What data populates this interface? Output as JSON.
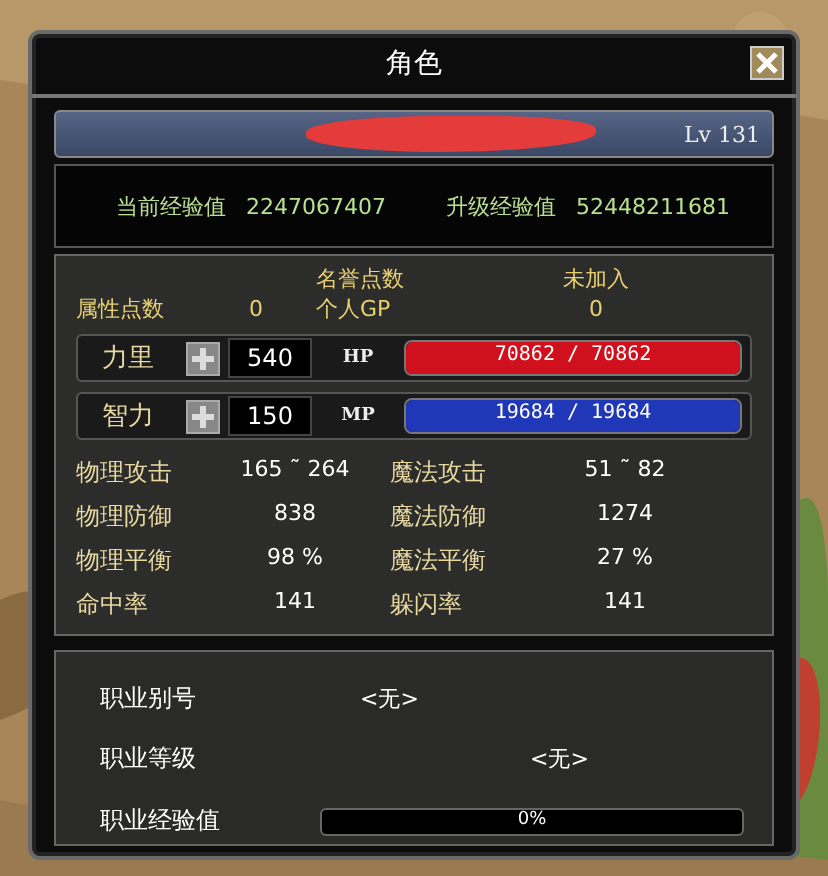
{
  "window": {
    "title": "角色"
  },
  "character": {
    "level": "Lv 131",
    "redacted": true
  },
  "experience": {
    "current_label": "当前经验值",
    "current": "2247067407",
    "next_label": "升级经验值",
    "next": "52448211681"
  },
  "points": {
    "attribute_label": "属性点数",
    "attribute": "0",
    "honor_label": "名誉点数",
    "honor": "未加入",
    "gp_label": "个人GP",
    "gp": "0"
  },
  "attributes": [
    {
      "label": "力里",
      "value": "540",
      "bar_label": "HP",
      "reading": "70862 / 70862",
      "level": 1,
      "color": "#d0101c"
    },
    {
      "label": "智力",
      "value": "150",
      "bar_label": "MP",
      "reading": "19684 / 19684",
      "level": 1,
      "color": "#2038b8"
    }
  ],
  "stats": [
    {
      "label": "物理攻击",
      "value": "165 ˜ 264"
    },
    {
      "label": "魔法攻击",
      "value": "51 ˜ 82"
    },
    {
      "label": "物理防御",
      "value": "838"
    },
    {
      "label": "魔法防御",
      "value": "1274"
    },
    {
      "label": "物理平衡",
      "value": "98 %"
    },
    {
      "label": "魔法平衡",
      "value": "27 %"
    },
    {
      "label": "命中率",
      "value": "141"
    },
    {
      "label": "躲闪率",
      "value": "141"
    }
  ],
  "job": {
    "alias_label": "职业别号",
    "alias": "<无>",
    "rank_label": "职业等级",
    "rank": "<无>",
    "exp_label": "职业经验值",
    "exp_reading": "0%",
    "level": 0
  }
}
